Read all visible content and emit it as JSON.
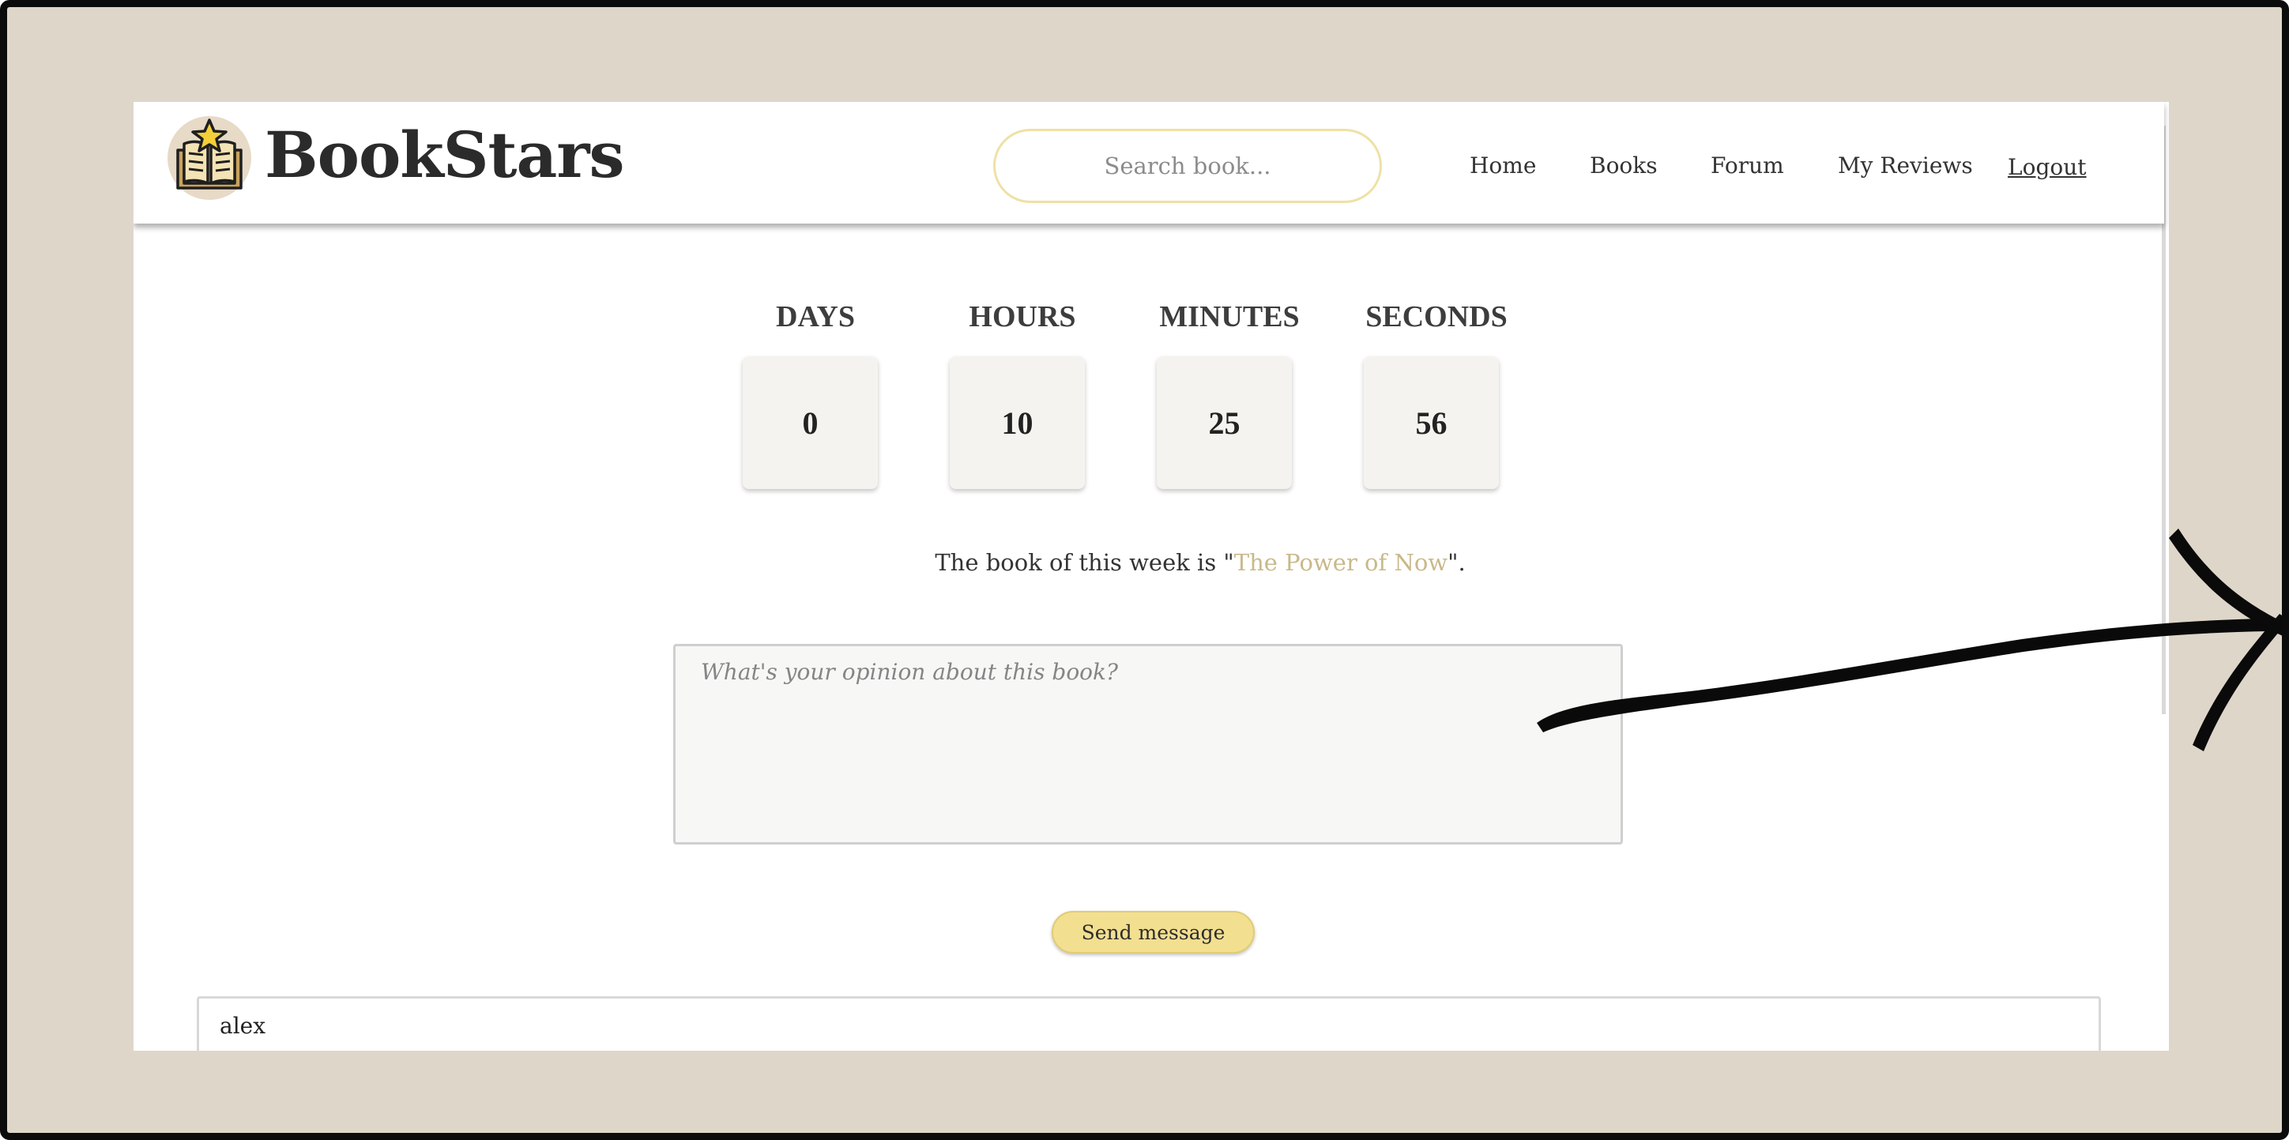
{
  "header": {
    "brand": "BookStars",
    "search_placeholder": "Search book...",
    "nav": {
      "home": "Home",
      "books": "Books",
      "forum": "Forum",
      "my_reviews": "My Reviews",
      "logout": "Logout"
    }
  },
  "countdown": {
    "labels": {
      "days": "DAYS",
      "hours": "HOURS",
      "minutes": "MINUTES",
      "seconds": "SECONDS"
    },
    "values": {
      "days": "0",
      "hours": "10",
      "minutes": "25",
      "seconds": "56"
    }
  },
  "week": {
    "prefix": "The book of this week is ",
    "quote_open": "\"",
    "title": "The Power of Now",
    "quote_close": "\"."
  },
  "opinion": {
    "placeholder": "What's your opinion about this book?",
    "send_label": "Send message"
  },
  "messages": [
    {
      "user": "alex"
    }
  ],
  "colors": {
    "accent": "#f2df90",
    "book_title": "#c9b98a",
    "frame_bg": "#dfd6ca",
    "frame_border": "#0b0b0b"
  },
  "icons": {
    "logo": "book-star-icon",
    "annotation": "arrow-annotation-icon"
  }
}
